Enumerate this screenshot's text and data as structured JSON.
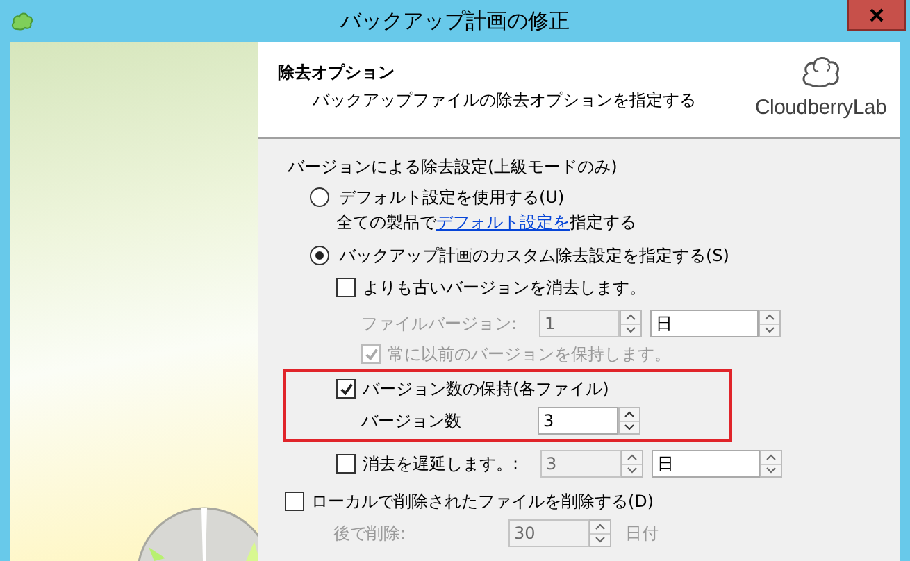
{
  "window": {
    "title": "バックアップ計画の修正"
  },
  "header": {
    "title": "除去オプション",
    "subtitle": "バックアップファイルの除去オプションを指定する",
    "logo": "CloudberryLab"
  },
  "section_title": "バージョンによる除去設定(上級モードのみ)",
  "use_default": {
    "label": "デフォルト設定を使用する(U)",
    "selected": false,
    "note_prefix": "全ての製品で",
    "note_link": "デフォルト設定を",
    "note_suffix": "指定する"
  },
  "custom": {
    "label": "バックアップ計画のカスタム除去設定を指定する(S)",
    "selected": true
  },
  "delete_older": {
    "label": "よりも古いバージョンを消去します。",
    "checked": false
  },
  "file_version": {
    "label": "ファイルバージョン:",
    "value": "1",
    "unit": "日",
    "disabled": true
  },
  "keep_previous": {
    "label": "常に以前のバージョンを保持します。",
    "checked": true,
    "disabled": true
  },
  "keep_versions": {
    "label": "バージョン数の保持(各ファイル)",
    "checked": true,
    "highlighted": true
  },
  "version_count": {
    "label": "バージョン数",
    "value": "3",
    "disabled": false
  },
  "delay": {
    "label": "消去を遅延します。:",
    "checked": false,
    "value": "3",
    "unit": "日",
    "disabled": true
  },
  "delete_local": {
    "label": "ローカルで削除されたファイルを削除する(D)",
    "checked": false
  },
  "delete_after": {
    "label": "後で削除:",
    "value": "30",
    "unit": "日付",
    "disabled": true
  }
}
